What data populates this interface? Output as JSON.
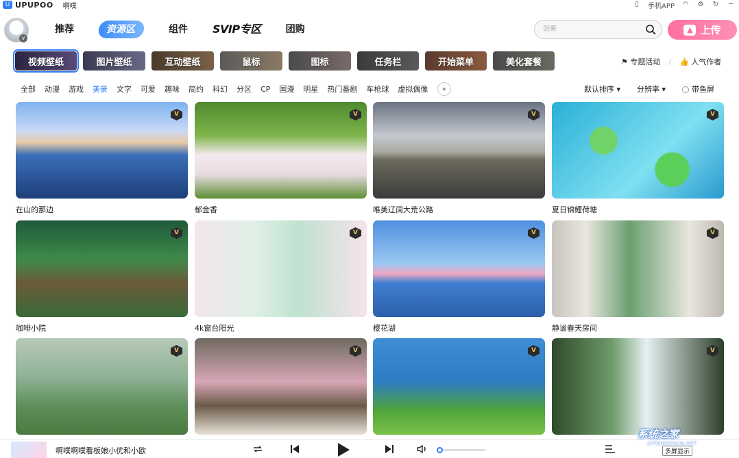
{
  "titlebar": {
    "logo_badge": "U",
    "app_name": "UPUPOO",
    "user_name": "啊噗",
    "mobile_app": "手机APP"
  },
  "nav": {
    "items": [
      {
        "label": "推荐"
      },
      {
        "label": "资源区"
      },
      {
        "label": "组件"
      },
      {
        "label": "SVIP专区"
      },
      {
        "label": "团购"
      }
    ],
    "active_index": 1
  },
  "search": {
    "placeholder": "剑来"
  },
  "upload": {
    "label": "上传"
  },
  "categories": [
    {
      "label": "视频壁纸"
    },
    {
      "label": "图片壁纸"
    },
    {
      "label": "互动壁纸"
    },
    {
      "label": "鼠标"
    },
    {
      "label": "图标"
    },
    {
      "label": "任务栏"
    },
    {
      "label": "开始菜单"
    },
    {
      "label": "美化套餐"
    }
  ],
  "category_links": {
    "topic": "专题活动",
    "popular_authors": "人气作者"
  },
  "tags": [
    "全部",
    "动漫",
    "游戏",
    "美景",
    "文字",
    "可爱",
    "趣味",
    "简约",
    "科幻",
    "分区",
    "CP",
    "国漫",
    "明星",
    "热门番剧",
    "车枪球",
    "虚拟偶像"
  ],
  "active_tag": "美景",
  "filters": {
    "sort": "默认排序",
    "resolution": "分辨率",
    "with_fish": "带鱼屏"
  },
  "wallpapers": [
    {
      "title": "在山的那边",
      "vip": "V"
    },
    {
      "title": "郁金香",
      "vip": "V"
    },
    {
      "title": "唯美辽阔大荒公路",
      "vip": "V"
    },
    {
      "title": "夏日锦鲤荷塘",
      "vip": "V"
    },
    {
      "title": "咖啡小院",
      "vip": "V"
    },
    {
      "title": "4k窗台阳光",
      "vip": "V"
    },
    {
      "title": "樱花湖",
      "vip": "V"
    },
    {
      "title": "静谧春天房间",
      "vip": "V"
    },
    {
      "title": "",
      "vip": "V"
    },
    {
      "title": "",
      "vip": "V"
    },
    {
      "title": "",
      "vip": "V"
    },
    {
      "title": "",
      "vip": "V"
    }
  ],
  "player": {
    "track": "啊噗啊噗看板娘小优和小欧",
    "multi_screen": "多屏显示"
  },
  "watermark": {
    "text": "系统之家",
    "url": "XITONGZHIJIA.NET"
  }
}
